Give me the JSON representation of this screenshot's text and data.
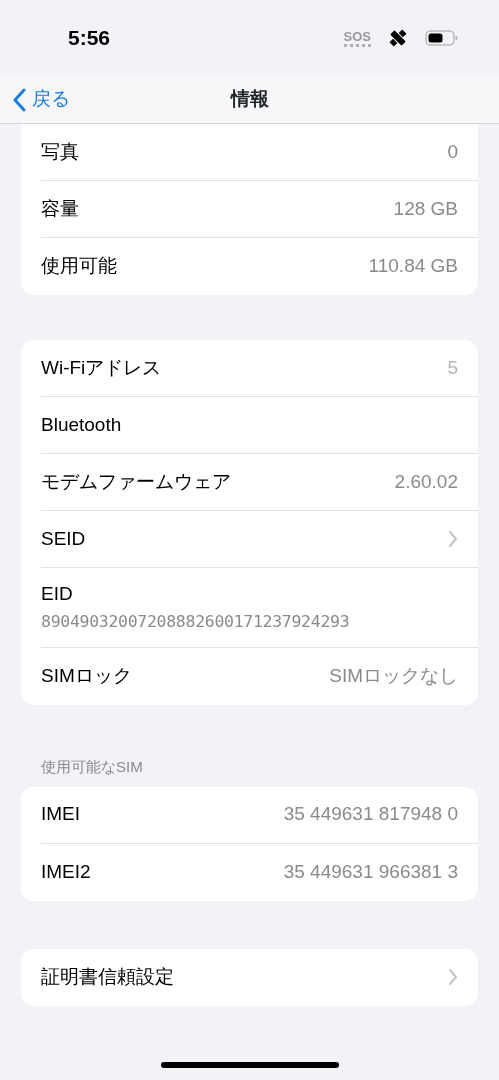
{
  "status_bar": {
    "time": "5:56",
    "sos": "SOS"
  },
  "nav": {
    "back": "戻る",
    "title": "情報"
  },
  "groups": [
    {
      "clipped_top": true,
      "rows": [
        {
          "kind": "value",
          "label": "写真",
          "value": "0"
        },
        {
          "kind": "value",
          "label": "容量",
          "value": "128 GB"
        },
        {
          "kind": "value",
          "label": "使用可能",
          "value": "110.84 GB"
        }
      ]
    },
    {
      "rows": [
        {
          "kind": "value",
          "label": "Wi-Fiアドレス",
          "value": "5",
          "blurred": true
        },
        {
          "kind": "value",
          "label": "Bluetooth"
        },
        {
          "kind": "value",
          "label": "モデムファームウェア",
          "value": "2.60.02"
        },
        {
          "kind": "chevron",
          "label": "SEID"
        },
        {
          "kind": "stacked",
          "label": "EID",
          "value": "89049032007208882600171237924293"
        },
        {
          "kind": "value",
          "label": "SIMロック",
          "value": "SIMロックなし"
        }
      ]
    },
    {
      "header": "使用可能なSIM",
      "rows": [
        {
          "kind": "value",
          "label": "IMEI",
          "value": "35 449631 817948 0"
        },
        {
          "kind": "value",
          "label": "IMEI2",
          "value": "35 449631 966381 3"
        }
      ]
    },
    {
      "rows": [
        {
          "kind": "chevron",
          "label": "証明書信頼設定"
        }
      ]
    }
  ]
}
